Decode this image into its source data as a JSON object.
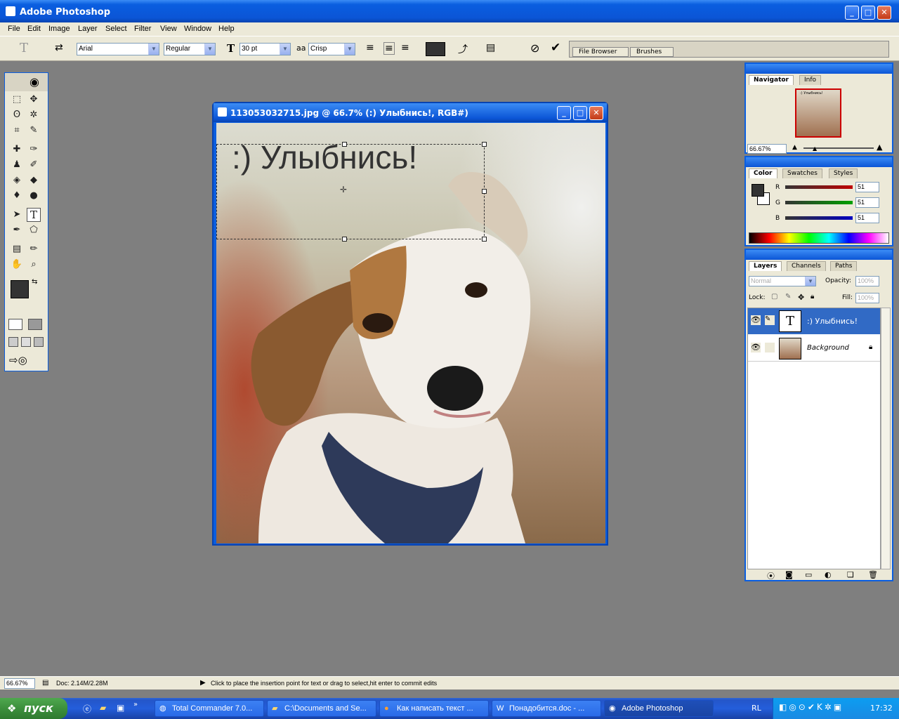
{
  "app": {
    "title": "Adobe Photoshop"
  },
  "menu": [
    "File",
    "Edit",
    "Image",
    "Layer",
    "Select",
    "Filter",
    "View",
    "Window",
    "Help"
  ],
  "options": {
    "font_family": "Arial",
    "font_style": "Regular",
    "font_size": "30 pt",
    "antialias": "Crisp",
    "antialias_label": "aa",
    "tabs": [
      "File Browser",
      "Brushes"
    ]
  },
  "document": {
    "title": "113053032715.jpg @ 66.7% (:) Улыбнись!, RGB#)",
    "text_layer": ":) Улыбнись!"
  },
  "navigator": {
    "tabs": [
      "Navigator",
      "Info"
    ],
    "zoom": "66.67%",
    "thumb_caption": ":) Улыбнись!"
  },
  "color": {
    "tabs": [
      "Color",
      "Swatches",
      "Styles"
    ],
    "channels": [
      {
        "label": "R",
        "value": "51",
        "accent": "#c00000"
      },
      {
        "label": "G",
        "value": "51",
        "accent": "#00a000"
      },
      {
        "label": "B",
        "value": "51",
        "accent": "#0000c0"
      }
    ],
    "foreground": "#333333",
    "background": "#ffffff"
  },
  "layers": {
    "tabs": [
      "Layers",
      "Channels",
      "Paths"
    ],
    "blend_mode": "Normal",
    "opacity_label": "Opacity:",
    "opacity": "100%",
    "lock_label": "Lock:",
    "fill_label": "Fill:",
    "fill": "100%",
    "items": [
      {
        "name": ":) Улыбнись!",
        "thumb": "T",
        "selected": true
      },
      {
        "name": "Background",
        "selected": false
      }
    ]
  },
  "status": {
    "zoom": "66.67%",
    "doc": "Doc: 2.14M/2.28M",
    "hint": "Click to place the insertion point for text or drag to select,hit enter to commit edits"
  },
  "taskbar": {
    "start": "пуск",
    "tasks": [
      "Total Commander 7.0...",
      "C:\\Documents and Se...",
      "Как написать текст ...",
      "Понадобится.doc - ...",
      "Adobe Photoshop"
    ],
    "lang": "RL",
    "time": "17:32"
  }
}
